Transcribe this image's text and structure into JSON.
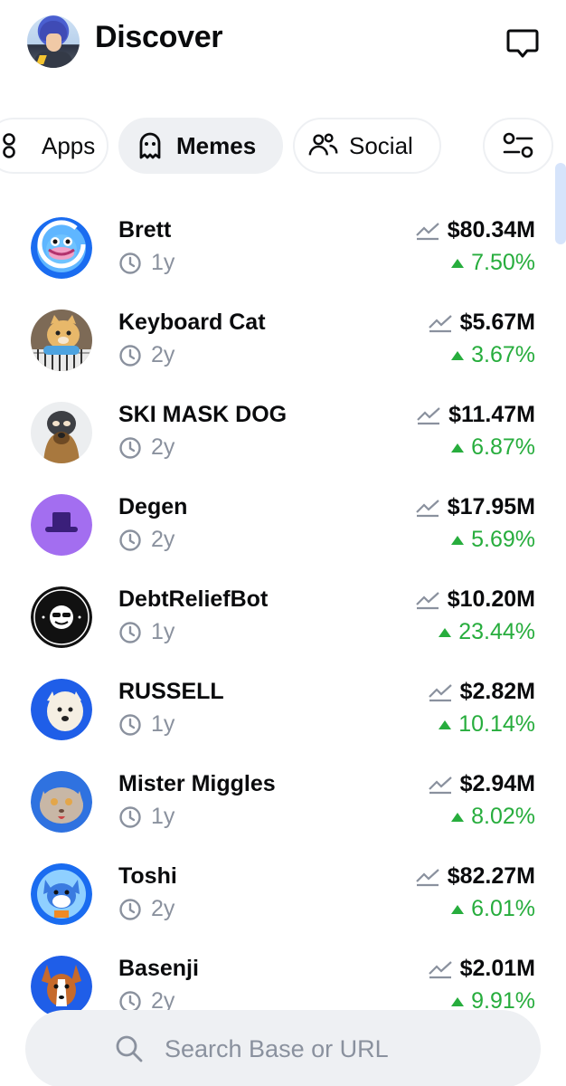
{
  "header": {
    "title": "Discover"
  },
  "tabs": [
    {
      "label": "Apps"
    },
    {
      "label": "Memes"
    },
    {
      "label": "Social"
    }
  ],
  "tokens": [
    {
      "name": "Brett",
      "age": "1y",
      "mcap": "$80.34M",
      "change": "7.50%"
    },
    {
      "name": "Keyboard Cat",
      "age": "2y",
      "mcap": "$5.67M",
      "change": "3.67%"
    },
    {
      "name": "SKI MASK DOG",
      "age": "2y",
      "mcap": "$11.47M",
      "change": "6.87%"
    },
    {
      "name": "Degen",
      "age": "2y",
      "mcap": "$17.95M",
      "change": "5.69%"
    },
    {
      "name": "DebtReliefBot",
      "age": "1y",
      "mcap": "$10.20M",
      "change": "23.44%"
    },
    {
      "name": "RUSSELL",
      "age": "1y",
      "mcap": "$2.82M",
      "change": "10.14%"
    },
    {
      "name": "Mister Miggles",
      "age": "1y",
      "mcap": "$2.94M",
      "change": "8.02%"
    },
    {
      "name": "Toshi",
      "age": "2y",
      "mcap": "$82.27M",
      "change": "6.01%"
    },
    {
      "name": "Basenji",
      "age": "2y",
      "mcap": "$2.01M",
      "change": "9.91%"
    }
  ],
  "search": {
    "placeholder": "Search Base or URL"
  },
  "colors": {
    "positive": "#27ad3d",
    "muted": "#8a919e",
    "chip_bg": "#eef0f3"
  }
}
